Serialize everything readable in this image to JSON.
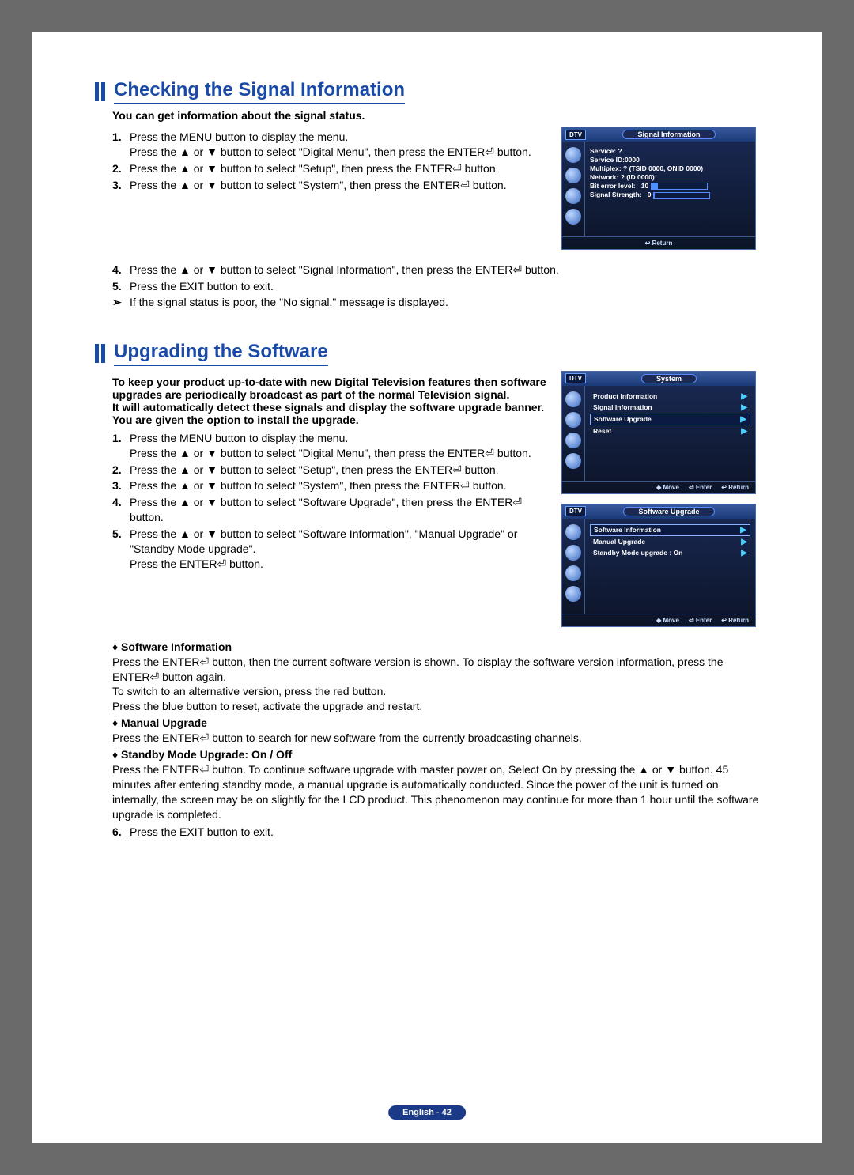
{
  "page": {
    "footer_badge": "English - 42"
  },
  "section1": {
    "title": "Checking the Signal Information",
    "intro": "You can get information about the signal status.",
    "steps": [
      "Press the MENU button to display the menu.\nPress the ▲ or ▼ button to select \"Digital Menu\", then press the ENTER⏎ button.",
      "Press the ▲ or ▼ button to select \"Setup\", then press the ENTER⏎ button.",
      "Press the ▲ or ▼ button to select \"System\", then press the ENTER⏎ button.",
      "Press the ▲ or ▼ button to select \"Signal Information\", then press the ENTER⏎ button.",
      "Press the EXIT button to exit."
    ],
    "note": "If the signal status is poor, the \"No signal.\" message is displayed."
  },
  "osd1": {
    "dtv": "DTV",
    "title": "Signal Information",
    "lines": {
      "service": "Service: ?",
      "service_id": "Service ID:0000",
      "multiplex": "Multiplex: ? (TSID 0000, ONID 0000)",
      "network": "Network: ? (ID 0000)",
      "bit_error_label": "Bit error level:",
      "bit_error_value": "10",
      "signal_strength_label": "Signal Strength:",
      "signal_strength_value": "0"
    },
    "footer_return": "↩ Return"
  },
  "section2": {
    "title": "Upgrading the Software",
    "intro": "To keep your product up-to-date with new Digital Television features then software upgrades are periodically broadcast as part of the normal Television signal.\nIt will automatically detect these signals and display the software upgrade banner. You are given the option to install the upgrade.",
    "steps": [
      "Press the MENU button to display the menu.\nPress the ▲ or ▼ button to select \"Digital Menu\", then press the ENTER⏎ button.",
      "Press the ▲ or ▼ button to select \"Setup\", then press the ENTER⏎ button.",
      "Press the ▲ or ▼ button to select \"System\", then press the ENTER⏎ button.",
      "Press the ▲ or ▼ button to select \"Software Upgrade\", then press the ENTER⏎ button.",
      "Press the ▲ or ▼ button to select \"Software Information\", \"Manual Upgrade\" or \"Standby Mode upgrade\".\nPress the ENTER⏎ button."
    ],
    "bullets": [
      {
        "title": "Software Information",
        "body": "Press the ENTER⏎ button, then the current software version is shown. To display the software version information, press the ENTER⏎ button again.\nTo switch to an alternative version, press the red button.\nPress the blue button to reset, activate the upgrade and restart."
      },
      {
        "title": "Manual Upgrade",
        "body": "Press the ENTER⏎ button to search for new software from the currently broadcasting channels."
      },
      {
        "title": "Standby Mode Upgrade: On / Off",
        "body": "Press the ENTER⏎ button. To continue software upgrade with master power on, Select On by pressing the ▲ or ▼ button. 45 minutes after entering standby mode, a manual upgrade is automatically conducted. Since the power of the unit is turned on internally, the screen may be on slightly for the LCD product. This phenomenon may continue for more than 1 hour until the software upgrade is completed."
      }
    ],
    "step6": "Press the EXIT button to exit."
  },
  "osd2": {
    "dtv": "DTV",
    "title": "System",
    "items": [
      "Product Information",
      "Signal Information",
      "Software Upgrade",
      "Reset"
    ],
    "footer": {
      "move": "◆ Move",
      "enter": "⏎ Enter",
      "ret": "↩ Return"
    }
  },
  "osd3": {
    "dtv": "DTV",
    "title": "Software Upgrade",
    "items": [
      "Software Information",
      "Manual Upgrade",
      "Standby Mode upgrade : On"
    ],
    "footer": {
      "move": "◆ Move",
      "enter": "⏎ Enter",
      "ret": "↩ Return"
    }
  }
}
